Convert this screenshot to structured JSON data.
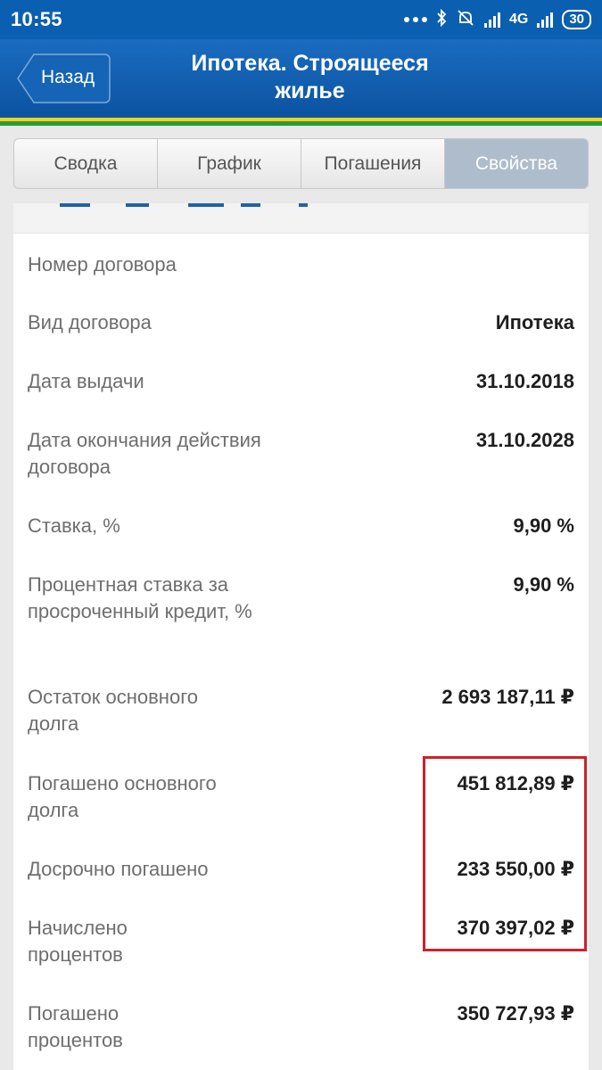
{
  "status_bar": {
    "time": "10:55",
    "network": "4G",
    "battery": "30"
  },
  "header": {
    "back_label": "Назад",
    "title_line1": "Ипотека. Строящееся",
    "title_line2": "жилье"
  },
  "tabs": [
    {
      "label": "Сводка",
      "active": false
    },
    {
      "label": "График",
      "active": false
    },
    {
      "label": "Погашения",
      "active": false
    },
    {
      "label": "Свойства",
      "active": true
    }
  ],
  "properties": [
    {
      "label": "Номер договора",
      "value": ""
    },
    {
      "label": "Вид договора",
      "value": "Ипотека"
    },
    {
      "label": "Дата выдачи",
      "value": "31.10.2018"
    },
    {
      "label": "Дата окончания действия договора",
      "value": "31.10.2028"
    },
    {
      "label": "Ставка, %",
      "value": "9,90 %"
    },
    {
      "label": "Процентная ставка за просроченный кредит, %",
      "value": "9,90 %"
    },
    {
      "label": "Остаток основного долга",
      "value": "2 693 187,11 ₽"
    },
    {
      "label": "Погашено основного долга",
      "value": "451 812,89 ₽"
    },
    {
      "label": "Досрочно погашено",
      "value": "233 550,00 ₽"
    },
    {
      "label": "Начислено процентов",
      "value": "370 397,02 ₽"
    },
    {
      "label": "Погашено процентов",
      "value": "350 727,93 ₽"
    }
  ],
  "colors": {
    "header_blue": "#0c54a2",
    "stripe_yellow": "#f3d11d",
    "stripe_green": "#2a9b3a",
    "highlight_red": "#d0202a"
  }
}
